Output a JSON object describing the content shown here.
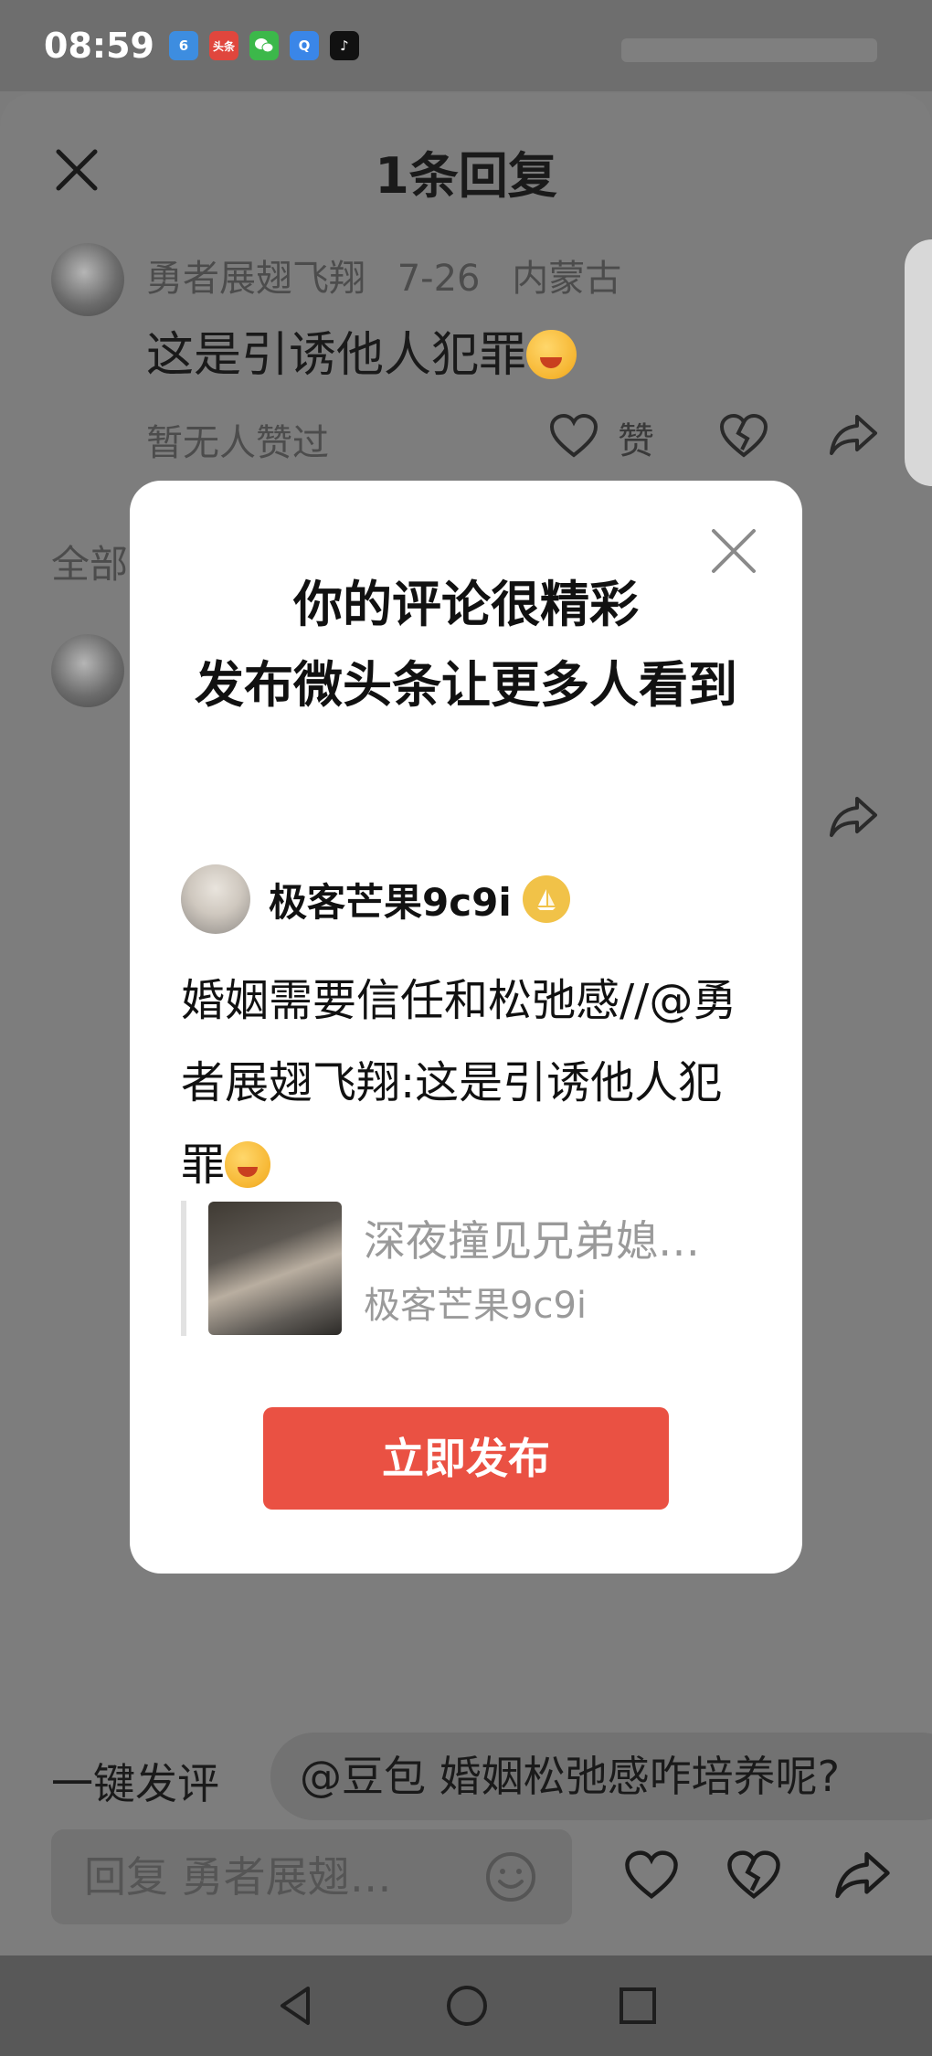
{
  "status_bar": {
    "time": "08:59",
    "apps": [
      "6",
      "头条",
      "",
      "Q",
      "♪"
    ]
  },
  "sheet": {
    "title": "1条回复",
    "comment": {
      "author": "勇者展翅飞翔",
      "date": "7-26",
      "location": "内蒙古",
      "text": "这是引诱他人犯罪",
      "no_likes": "暂无人赞过",
      "like_label": "赞"
    },
    "all_label": "全部"
  },
  "modal": {
    "headline_line1": "你的评论很精彩",
    "headline_line2": "发布微头条让更多人看到",
    "username": "极客芒果9c9i",
    "post_text": "婚姻需要信任和松弛感//@勇者展翅飞翔:这是引诱他人犯罪",
    "quote_title": "深夜撞见兄弟媳…",
    "quote_author": "极客芒果9c9i",
    "publish_button": "立即发布"
  },
  "bottom": {
    "quick_label": "一键发评",
    "quick_suggestion": "@豆包 婚姻松弛感咋培养呢?",
    "reply_placeholder": "回复 勇者展翅…"
  },
  "colors": {
    "accent": "#ea5143",
    "badge": "#f1c248",
    "overlay": "#7b7b7b"
  }
}
